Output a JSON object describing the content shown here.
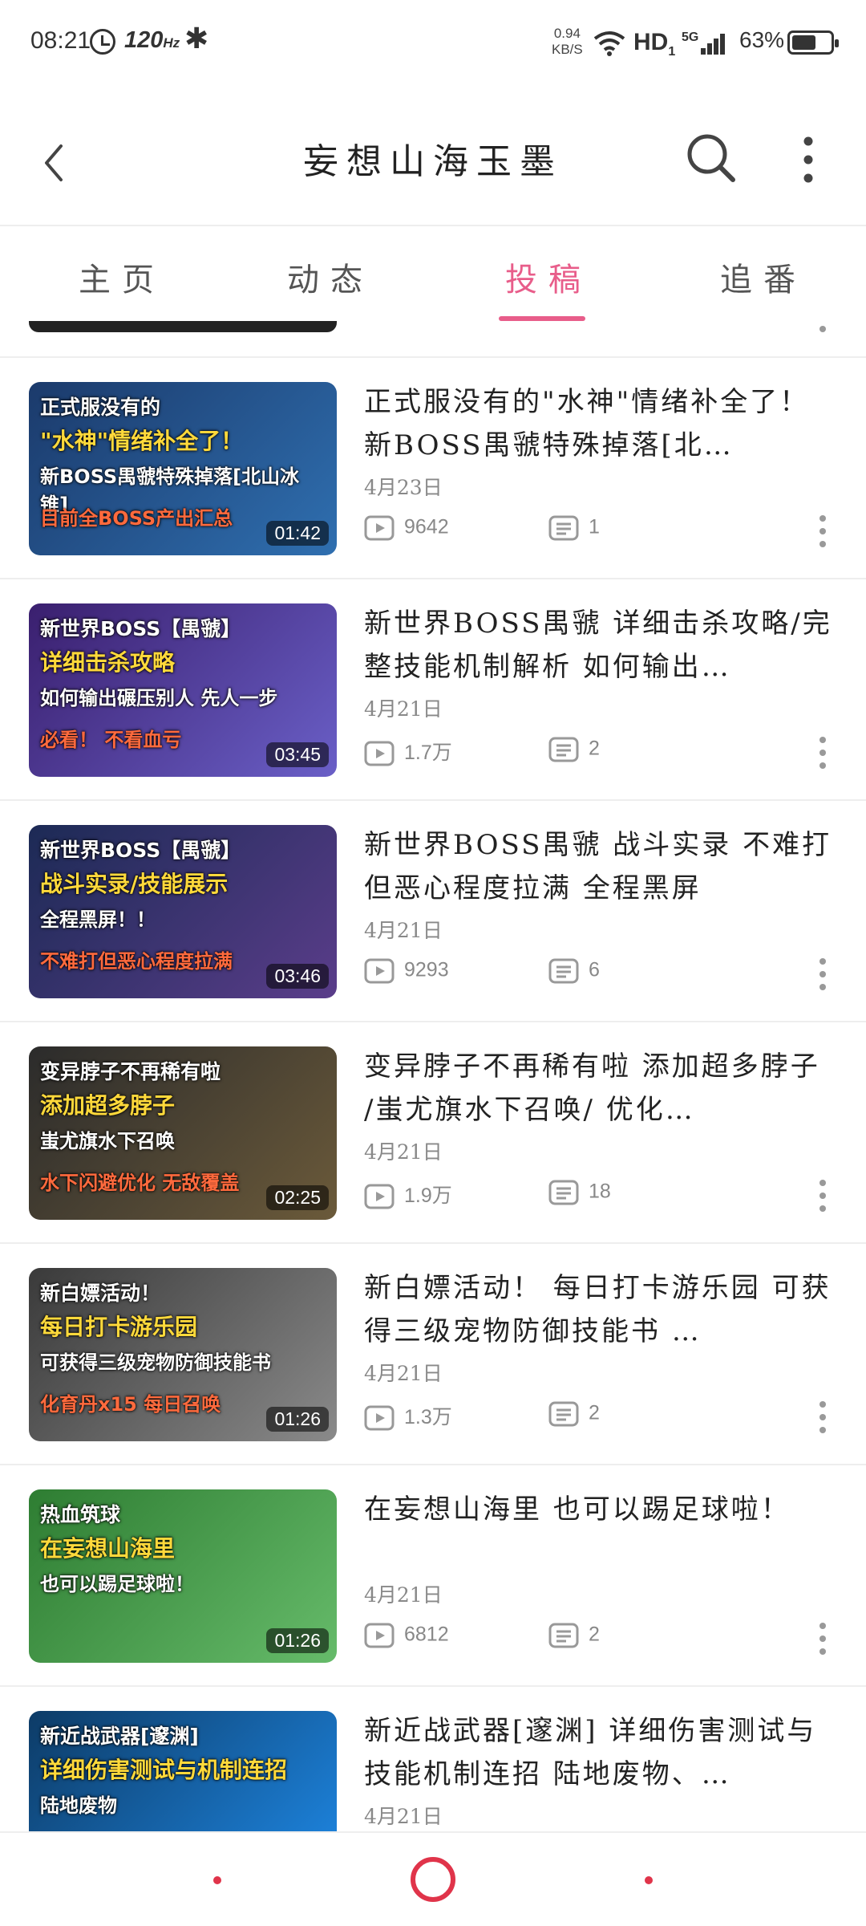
{
  "status_bar": {
    "time": "08:21",
    "refresh_rate": "120",
    "refresh_unit": "Hz",
    "net_speed_value": "0.94",
    "net_speed_unit": "KB/S",
    "hd_label": "HD",
    "hd_sub": "1",
    "network_type": "5G",
    "battery_percent": "63%",
    "battery_level": 0.63
  },
  "header": {
    "title": "妄想山海玉墨"
  },
  "tabs": [
    {
      "label": "主页",
      "active": false
    },
    {
      "label": "动态",
      "active": false
    },
    {
      "label": "投稿",
      "active": true
    },
    {
      "label": "追番",
      "active": false
    }
  ],
  "accent_color": "#e85d8a",
  "videos": [
    {
      "title": "正式服没有的\"水神\"情绪补全了！ 新BOSS禺虢特殊掉落[北…",
      "date": "4月23日",
      "views": "9642",
      "comments": "1",
      "duration": "01:42",
      "thumb_text": [
        "正式服没有的",
        "\"水神\"情绪补全了！",
        "新BOSS禺虢特殊掉落[北山冰锥]",
        "目前全BOSS产出汇总"
      ],
      "thumb_colors": [
        "#1b3a6b",
        "#2f6fb0"
      ]
    },
    {
      "title": "新世界BOSS禺虢 详细击杀攻略/完整技能机制解析 如何输出…",
      "date": "4月21日",
      "views": "1.7万",
      "comments": "2",
      "duration": "03:45",
      "thumb_text": [
        "新世界BOSS【禺虢】",
        "详细击杀攻略",
        "如何输出碾压别人 先人一步",
        "必看！ 不看血亏"
      ],
      "thumb_colors": [
        "#3a1f6e",
        "#6a5fc7"
      ]
    },
    {
      "title": "新世界BOSS禺虢 战斗实录 不难打但恶心程度拉满 全程黑屏",
      "date": "4月21日",
      "views": "9293",
      "comments": "6",
      "duration": "03:46",
      "thumb_text": [
        "新世界BOSS【禺虢】",
        "战斗实录/技能展示",
        "全程黑屏！！",
        "不难打但恶心程度拉满"
      ],
      "thumb_colors": [
        "#1c2a55",
        "#5a3d8a"
      ]
    },
    {
      "title": "变异脖子不再稀有啦 添加超多脖子 /蚩尤旗水下召唤/ 优化…",
      "date": "4月21日",
      "views": "1.9万",
      "comments": "18",
      "duration": "02:25",
      "thumb_text": [
        "变异脖子不再稀有啦",
        "添加超多脖子",
        "蚩尤旗水下召唤",
        "水下闪避优化 无敌覆盖"
      ],
      "thumb_colors": [
        "#2b2b2b",
        "#6b5a3a"
      ]
    },
    {
      "title": "新白嫖活动！ 每日打卡游乐园 可获得三级宠物防御技能书 …",
      "date": "4月21日",
      "views": "1.3万",
      "comments": "2",
      "duration": "01:26",
      "thumb_text": [
        "新白嫖活动！",
        "每日打卡游乐园",
        "可获得三级宠物防御技能书",
        "化育丹x15 每日召唤"
      ],
      "thumb_colors": [
        "#3a3a3a",
        "#8a8a8a"
      ]
    },
    {
      "title": "在妄想山海里 也可以踢足球啦！",
      "date": "4月21日",
      "views": "6812",
      "comments": "2",
      "duration": "01:26",
      "thumb_text": [
        "热血筑球",
        "在妄想山海里",
        "也可以踢足球啦！",
        ""
      ],
      "thumb_colors": [
        "#2e7d32",
        "#66bb6a"
      ]
    },
    {
      "title": "新近战武器[邃渊] 详细伤害测试与技能机制连招 陆地废物、…",
      "date": "4月21日",
      "views": "",
      "comments": "",
      "duration": "",
      "thumb_text": [
        "新近战武器[邃渊]",
        "详细伤害测试与机制连招",
        "陆地废物",
        ""
      ],
      "thumb_colors": [
        "#0d3b66",
        "#1e88e5"
      ]
    }
  ],
  "bottom_nav_color": "#e0344a"
}
